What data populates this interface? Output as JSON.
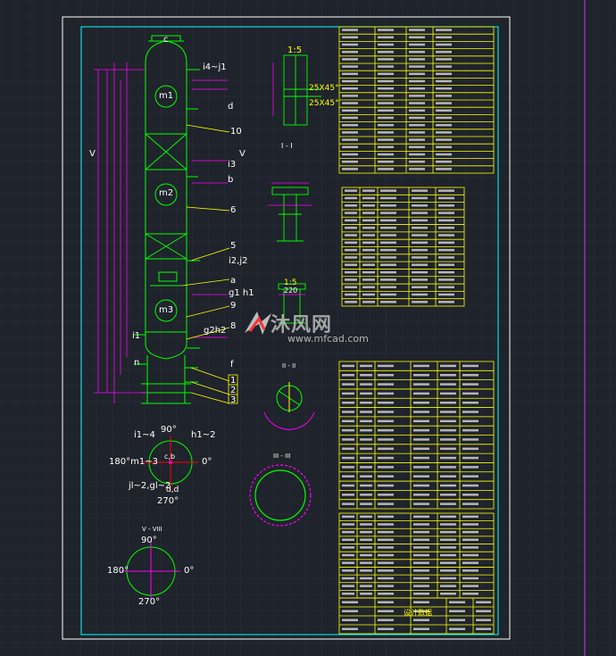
{
  "colors": {
    "background": "#1f232b",
    "grid": "#2a2f38",
    "frame": "#ffffff",
    "border": "#00ffff",
    "vessel": "#00ff00",
    "dimension": "#ff00ff",
    "table": "#ffff00",
    "text": "#ffffff",
    "leader": "#ffff00",
    "watermark": "#bbbbbb"
  },
  "labels": {
    "shell_c": "c",
    "nozzle_i4_j1": "i4~j1",
    "nozzle_d": "d",
    "item_10": "10",
    "manhole_m1": "m1",
    "nozzle_i3": "i3",
    "nozzle_b": "b",
    "manhole_m2": "m2",
    "item_6": "6",
    "item_5": "5",
    "nozzle_i2_j2": "i2,j2",
    "nozzle_a": "a",
    "nozzle_g1h1": "g1 h1",
    "item_9": "9",
    "manhole_m3": "m3",
    "item_8": "8",
    "nozzle_g2h2": "g2h2",
    "nozzle_i1": "i1",
    "nozzle_n": "n",
    "nozzle_f": "f",
    "item_1": "1",
    "item_2": "2",
    "item_3": "3",
    "section_v": "V",
    "section_v2": "V",
    "detail_scale_1": "1:5",
    "detail_chamfer_1": "25X45°",
    "detail_chamfer_2": "25X45°",
    "detail_ii": "I - I",
    "detail_scale_2": "1:5",
    "detail_220": "220",
    "plan_90": "90°",
    "plan_180": "180°m1~3",
    "plan_0": "0°",
    "plan_270": "270°",
    "plan_i1_i4": "i1~4",
    "plan_h1_2": "h1~2",
    "plan_jl": "jl~2,gl~2",
    "plan_cb": "c,b",
    "plan_dd": "d,d",
    "plan2_90": "90°",
    "plan2_180": "180°",
    "plan2_0": "0°",
    "plan2_270": "270°",
    "plan2_title": "V - VIII",
    "section_iii_title": "II - II",
    "section_iv_title": "III - III",
    "title_block": "设计数据"
  },
  "watermark": {
    "brand": "沐风网",
    "url": "www.mfcad.com"
  }
}
